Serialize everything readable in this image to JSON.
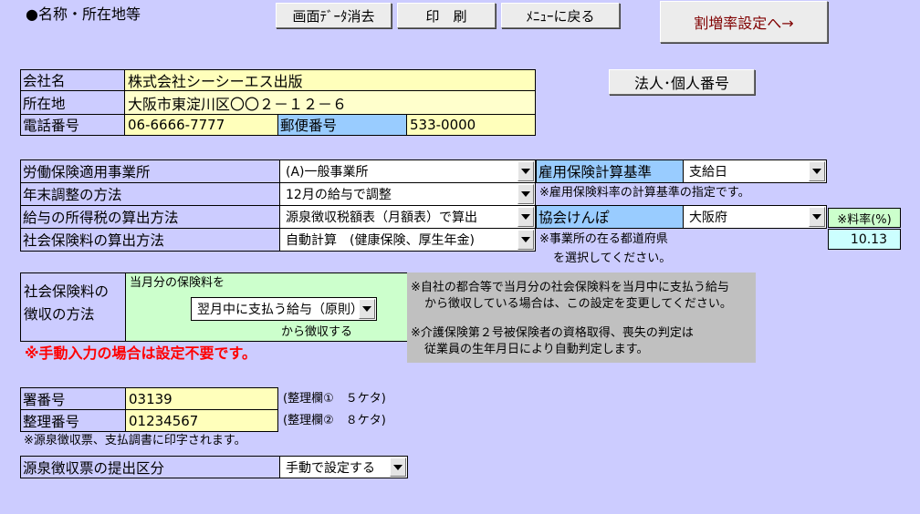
{
  "header": {
    "section_title": "●名称・所在地等",
    "clear_button": "画面ﾃﾞｰﾀ消去",
    "print_button": "印　刷",
    "menu_button": "ﾒﾆｭｰに戻る",
    "surcharge_button": "割増率設定へ→"
  },
  "company": {
    "name_label": "会社名",
    "name_value": "株式会社シーシーエス出版",
    "address_label": "所在地",
    "address_value": "大阪市東淀川区〇〇２－１２－６",
    "phone_label": "電話番号",
    "phone_value": "06-6666-7777",
    "zip_label": "郵便番号",
    "zip_value": "533-0000",
    "corp_number_button": "法人･個人番号"
  },
  "settings": {
    "labor_ins_label": "労働保険適用事業所",
    "labor_ins_value": "(A)一般事業所",
    "employment_calc_label": "雇用保険計算基準",
    "employment_calc_value": "支給日",
    "employment_note": "※雇用保険料率の計算基準の指定です。",
    "year_end_label": "年末調整の方法",
    "year_end_value": "12月の給与で調整",
    "income_tax_label": "給与の所得税の算出方法",
    "income_tax_value": "源泉徴収税額表（月額表）で算出",
    "kenpo_label": "協会けんぽ",
    "kenpo_value": "大阪府",
    "rate_label": "※料率(%)",
    "rate_value": "10.13",
    "social_ins_label": "社会保険料の算出方法",
    "social_ins_value": "自動計算　(健康保険、厚生年金)",
    "prefecture_note_1": "※事業所の在る都道府県",
    "prefecture_note_2": "を選択してください。"
  },
  "collection": {
    "label_line1": "社会保険料の",
    "label_line2": "徴収の方法",
    "current_month_text": "当月分の保険料を",
    "select_value": "翌月中に支払う給与（原則）",
    "from_text": "から徴収する",
    "note1_line1": "※自社の都合等で当月分の社会保険料を当月中に支払う給与",
    "note1_line2": "から徴収している場合は、この設定を変更してください。",
    "note2_line1": "※介護保険第２号被保険者の資格取得、喪失の判定は",
    "note2_line2": "従業員の生年月日により自動判定します。",
    "manual_warning": "※手動入力の場合は設定不要です。"
  },
  "tax_office": {
    "office_number_label": "署番号",
    "office_number_value": "03139",
    "office_number_note": "(整理欄①　５ケタ)",
    "ref_number_label": "整理番号",
    "ref_number_value": "01234567",
    "ref_number_note": "(整理欄②　８ケタ)",
    "print_note": "※源泉徴収票、支払調書に印字されます。",
    "submission_label": "源泉徴収票の提出区分",
    "submission_value": "手動で設定する"
  },
  "colors": {
    "background": "#ccccff",
    "label_blue": "#99ccff",
    "input_yellow": "#ffffbb",
    "collection_green": "#ccffcc",
    "note_gray": "#c0c0c0",
    "warning_red": "#ff0000",
    "surcharge_text": "#800000"
  }
}
